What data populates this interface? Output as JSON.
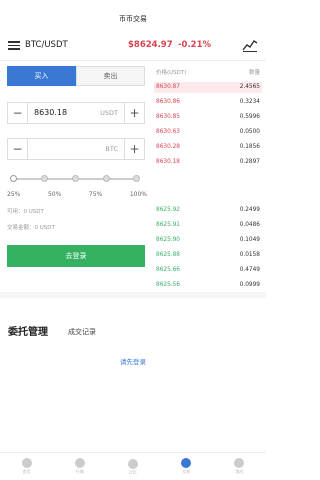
{
  "header": {
    "title": "币币交易"
  },
  "pair": {
    "name": "BTC/USDT",
    "price": "$8624.97",
    "change": "-0.21%"
  },
  "trade": {
    "tabs": {
      "buy": "买入",
      "sell": "卖出"
    },
    "price_field": {
      "value": "8630.18",
      "unit": "USDT"
    },
    "amount_field": {
      "value": "",
      "unit": "BTC"
    },
    "percentages": [
      "25%",
      "50%",
      "75%",
      "100%"
    ],
    "available": "可用：0 USDT",
    "volume": "交易金额：0 USDT",
    "login_button": "去登录"
  },
  "order_book": {
    "head": {
      "price": "价格(USDT)",
      "amount": "数量"
    },
    "asks": [
      {
        "price": "8630.87",
        "amount": "2.4565"
      },
      {
        "price": "8630.86",
        "amount": "0.3234"
      },
      {
        "price": "8630.85",
        "amount": "0.5996"
      },
      {
        "price": "8630.63",
        "amount": "0.0500"
      },
      {
        "price": "8630.28",
        "amount": "0.1856"
      },
      {
        "price": "8630.18",
        "amount": "0.2897"
      }
    ],
    "bids": [
      {
        "price": "8625.92",
        "amount": "0.2499"
      },
      {
        "price": "8625.91",
        "amount": "0.0486"
      },
      {
        "price": "8625.90",
        "amount": "0.1049"
      },
      {
        "price": "8625.88",
        "amount": "0.0158"
      },
      {
        "price": "8625.66",
        "amount": "0.4749"
      },
      {
        "price": "8625.56",
        "amount": "0.0999"
      }
    ]
  },
  "orders": {
    "title": "委托管理",
    "tab": "成交记录",
    "login_link": "请先登录"
  },
  "nav": {
    "items": [
      "首页",
      "行情",
      "OTC",
      "交易",
      "我的"
    ]
  },
  "colors": {
    "accent": "#3a78d6",
    "up": "#35b162",
    "down": "#d8434f"
  }
}
